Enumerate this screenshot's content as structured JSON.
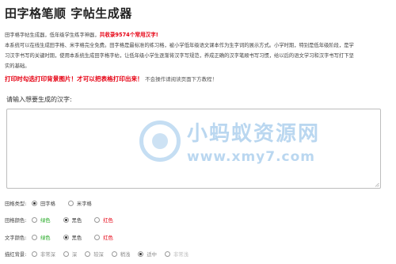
{
  "header": {
    "title": "田字格笔顺 字帖生成器"
  },
  "intro": {
    "line1_prefix": "田字格字帖生成器，低年级学生练字神器，",
    "line1_highlight": "共收录9574个常用汉字!",
    "line2": "本系统可以在线生成田字格、米字格完全免费。田字格是最标准的练习格，被小学低年级语文课本作为生字词的展示方式。小学时期，特别是低年级阶段，是学",
    "line3": "习汉字书写的关键时期，使用本系统生成田字格字帖，让低年级小学生逐渐将汉字写规范，养成正确的汉字笔顺书写习惯，给以后的语文学习和汉字书写打下坚",
    "line4": "实的基础。"
  },
  "print_note": {
    "highlight": "打印时勾选打印背景图片！才可以把表格打印出来！",
    "tail": "不会操作请阅读页面下方教程！"
  },
  "input": {
    "prompt": "请输入想要生成的汉字:",
    "value": ""
  },
  "watermark": {
    "text_cn": "小蚂蚁资源网",
    "text_url": "www.xmy7.com"
  },
  "options": {
    "grid_type": {
      "label": "田格类型:",
      "choices": [
        "田字格",
        "米字格"
      ],
      "selected": 0
    },
    "grid_color": {
      "label": "田格颜色:",
      "choices": [
        "绿色",
        "黑色",
        "红色"
      ],
      "selected": 1
    },
    "text_color": {
      "label": "文字颜色:",
      "choices": [
        "绿色",
        "黑色",
        "红色"
      ],
      "selected": 1
    },
    "trace_bg": {
      "label": "描红背景:",
      "choices": [
        "非常深",
        "深",
        "较深",
        "稍浅",
        "适中",
        "非常浅"
      ],
      "selected": 4
    }
  },
  "colors": {
    "accent_red": "#e60012",
    "green": "#22a822",
    "watermark_blue": "#5aa0dc"
  }
}
